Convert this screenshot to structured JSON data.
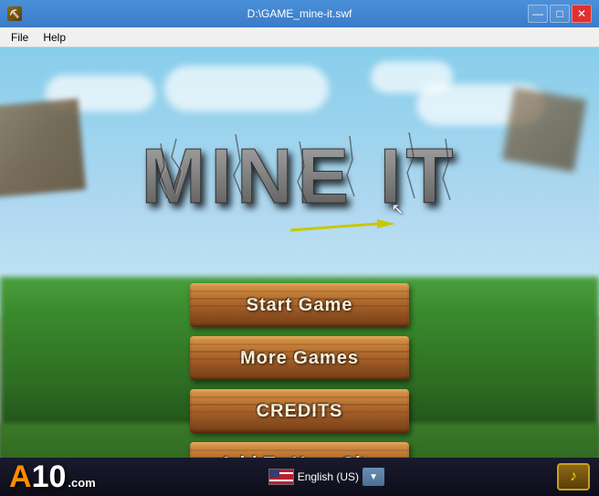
{
  "window": {
    "title": "D:\\GAME_mine-it.swf",
    "icon": "⛏"
  },
  "titlebar": {
    "minimize_label": "—",
    "maximize_label": "□",
    "close_label": "✕"
  },
  "menubar": {
    "items": [
      {
        "label": "File"
      },
      {
        "label": "Help"
      }
    ]
  },
  "game": {
    "logo_text": "MINE IT",
    "buttons": [
      {
        "id": "start",
        "label": "Start Game"
      },
      {
        "id": "more",
        "label": "More Games"
      },
      {
        "id": "credits",
        "label": "CREDITS"
      },
      {
        "id": "add",
        "label": "Add To Your Site"
      }
    ]
  },
  "bottom": {
    "a10_a": "A",
    "a10_10": "10",
    "a10_com": ".com",
    "lang_text": "English (US)",
    "music_icon": "♪"
  }
}
